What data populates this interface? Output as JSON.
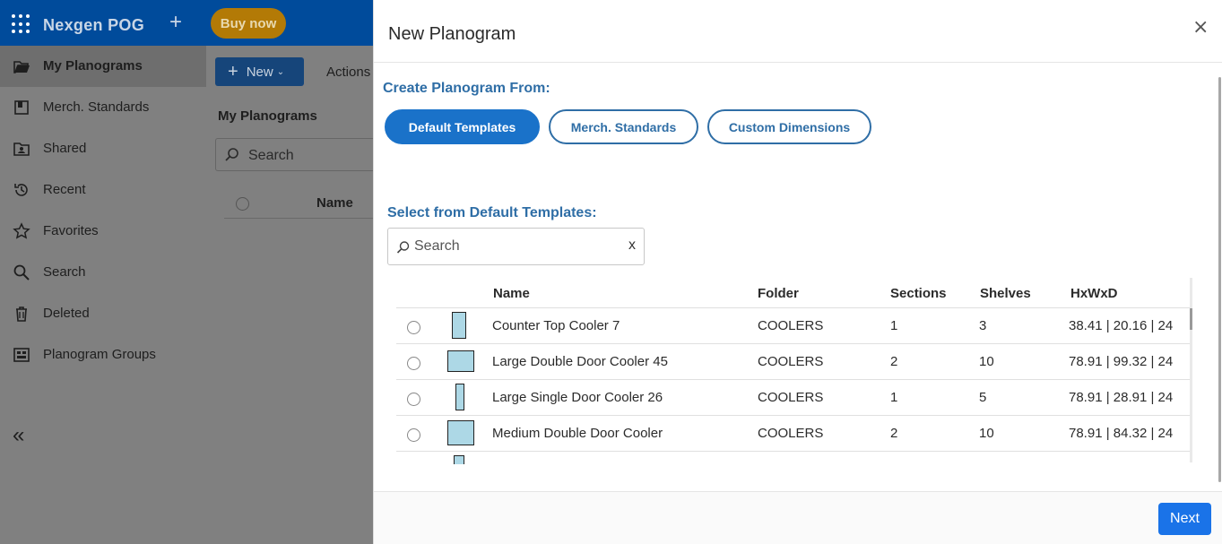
{
  "app": {
    "title": "Nexgen POG",
    "buy_now": "Buy now"
  },
  "sidebar": {
    "items": [
      {
        "label": "My Planograms",
        "icon": "folder-open-icon",
        "active": true
      },
      {
        "label": "Merch. Standards",
        "icon": "merch-standards-icon"
      },
      {
        "label": "Shared",
        "icon": "shared-folder-icon"
      },
      {
        "label": "Recent",
        "icon": "history-icon"
      },
      {
        "label": "Favorites",
        "icon": "star-icon"
      },
      {
        "label": "Search",
        "icon": "search-icon"
      },
      {
        "label": "Deleted",
        "icon": "trash-icon"
      },
      {
        "label": "Planogram Groups",
        "icon": "planogram-groups-icon"
      }
    ],
    "collapse_icon": "double-chevron-left-icon"
  },
  "main": {
    "new_label": "New",
    "actions_label": "Actions",
    "section_title": "My Planograms",
    "search_placeholder": "Search",
    "name_header": "Name"
  },
  "modal": {
    "title": "New Planogram",
    "close": "×",
    "create_from_label": "Create Planogram From:",
    "tabs": [
      {
        "label": "Default Templates",
        "active": true
      },
      {
        "label": "Merch. Standards",
        "active": false
      },
      {
        "label": "Custom Dimensions",
        "active": false
      }
    ],
    "select_label": "Select from Default Templates:",
    "search": {
      "placeholder": "Search",
      "value": "",
      "clear": "x"
    },
    "table": {
      "columns": [
        "Name",
        "Folder",
        "Sections",
        "Shelves",
        "HxWxD"
      ],
      "rows": [
        {
          "name": "Counter Top Cooler 7",
          "folder": "COOLERS",
          "sections": "1",
          "shelves": "3",
          "dims": "38.41 | 20.16 | 24"
        },
        {
          "name": "Large Double Door Cooler 45",
          "folder": "COOLERS",
          "sections": "2",
          "shelves": "10",
          "dims": "78.91 | 99.32 | 24"
        },
        {
          "name": "Large Single Door Cooler 26",
          "folder": "COOLERS",
          "sections": "1",
          "shelves": "5",
          "dims": "78.91 | 28.91 | 24"
        },
        {
          "name": "Medium Double Door Cooler",
          "folder": "COOLERS",
          "sections": "2",
          "shelves": "10",
          "dims": "78.91 | 84.32 | 24"
        }
      ]
    },
    "next_label": "Next",
    "colors": {
      "accent": "#1a72c9",
      "label_blue": "#2f6ea6",
      "thumb_fill": "#add8e6"
    }
  }
}
